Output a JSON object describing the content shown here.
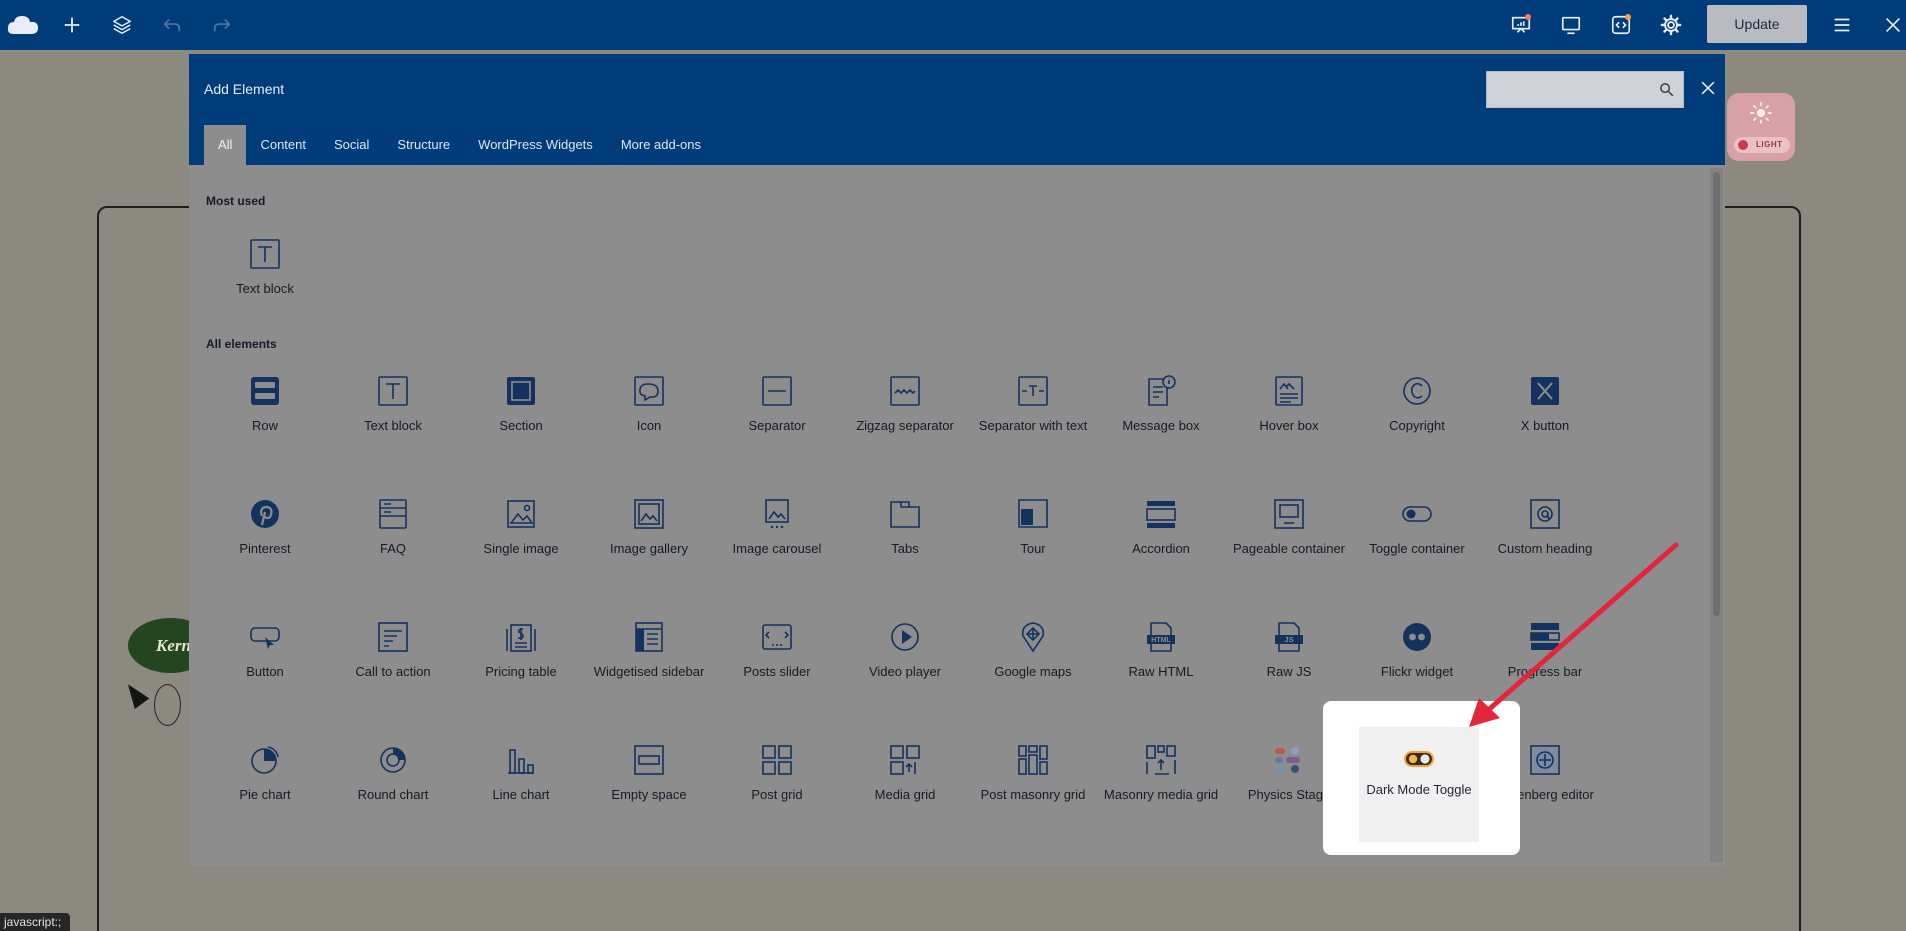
{
  "topbar": {
    "update_label": "Update",
    "icons": [
      "cloud-logo-icon",
      "plus-icon",
      "layers-icon",
      "undo-icon",
      "redo-icon",
      "presentation-icon",
      "monitor-icon",
      "code-icon",
      "settings-icon",
      "menu-icon",
      "close-icon"
    ]
  },
  "modal": {
    "title": "Add Element",
    "search_placeholder": "",
    "tabs": [
      "All",
      "Content",
      "Social",
      "Structure",
      "WordPress Widgets",
      "More add-ons"
    ],
    "active_tab": "All",
    "most_used_title": "Most used",
    "all_elements_title": "All elements",
    "most_used": [
      {
        "name": "text-block",
        "label": "Text block",
        "icon": "text-block-icon"
      }
    ],
    "elements": [
      {
        "name": "row",
        "label": "Row",
        "icon": "row-icon"
      },
      {
        "name": "text-block",
        "label": "Text block",
        "icon": "text-block-icon"
      },
      {
        "name": "section",
        "label": "Section",
        "icon": "section-icon"
      },
      {
        "name": "icon",
        "label": "Icon",
        "icon": "icon-element-icon"
      },
      {
        "name": "separator",
        "label": "Separator",
        "icon": "separator-icon"
      },
      {
        "name": "zigzag-separator",
        "label": "Zigzag separator",
        "icon": "zigzag-separator-icon"
      },
      {
        "name": "separator-with-text",
        "label": "Separator with text",
        "icon": "separator-text-icon"
      },
      {
        "name": "message-box",
        "label": "Message box",
        "icon": "message-box-icon"
      },
      {
        "name": "hover-box",
        "label": "Hover box",
        "icon": "hover-box-icon"
      },
      {
        "name": "copyright",
        "label": "Copyright",
        "icon": "copyright-icon"
      },
      {
        "name": "x-button",
        "label": "X button",
        "icon": "x-logo-icon"
      },
      {
        "name": "pinterest",
        "label": "Pinterest",
        "icon": "pinterest-icon"
      },
      {
        "name": "faq",
        "label": "FAQ",
        "icon": "faq-icon"
      },
      {
        "name": "single-image",
        "label": "Single image",
        "icon": "image-icon"
      },
      {
        "name": "image-gallery",
        "label": "Image gallery",
        "icon": "image-gallery-icon"
      },
      {
        "name": "image-carousel",
        "label": "Image carousel",
        "icon": "image-carousel-icon"
      },
      {
        "name": "tabs",
        "label": "Tabs",
        "icon": "tabs-icon"
      },
      {
        "name": "tour",
        "label": "Tour",
        "icon": "tour-icon"
      },
      {
        "name": "accordion",
        "label": "Accordion",
        "icon": "accordion-icon"
      },
      {
        "name": "pageable-container",
        "label": "Pageable container",
        "icon": "pageable-container-icon"
      },
      {
        "name": "toggle-container",
        "label": "Toggle container",
        "icon": "toggle-icon"
      },
      {
        "name": "custom-heading",
        "label": "Custom heading",
        "icon": "custom-heading-icon"
      },
      {
        "name": "button",
        "label": "Button",
        "icon": "button-icon"
      },
      {
        "name": "call-to-action",
        "label": "Call to action",
        "icon": "call-to-action-icon"
      },
      {
        "name": "pricing-table",
        "label": "Pricing table",
        "icon": "pricing-table-icon"
      },
      {
        "name": "widgetised-sidebar",
        "label": "Widgetised sidebar",
        "icon": "sidebar-icon"
      },
      {
        "name": "posts-slider",
        "label": "Posts slider",
        "icon": "posts-slider-icon"
      },
      {
        "name": "video-player",
        "label": "Video player",
        "icon": "play-icon"
      },
      {
        "name": "google-maps",
        "label": "Google maps",
        "icon": "map-pin-icon"
      },
      {
        "name": "raw-html",
        "label": "Raw HTML",
        "icon": "html-file-icon"
      },
      {
        "name": "raw-js",
        "label": "Raw JS",
        "icon": "js-file-icon"
      },
      {
        "name": "flickr-widget",
        "label": "Flickr widget",
        "icon": "flickr-icon"
      },
      {
        "name": "progress-bar",
        "label": "Progress bar",
        "icon": "progress-bar-icon"
      },
      {
        "name": "pie-chart",
        "label": "Pie chart",
        "icon": "pie-chart-icon"
      },
      {
        "name": "round-chart",
        "label": "Round chart",
        "icon": "round-chart-icon"
      },
      {
        "name": "line-chart",
        "label": "Line chart",
        "icon": "line-chart-icon"
      },
      {
        "name": "empty-space",
        "label": "Empty space",
        "icon": "empty-space-icon"
      },
      {
        "name": "post-grid",
        "label": "Post grid",
        "icon": "grid-icon"
      },
      {
        "name": "media-grid",
        "label": "Media grid",
        "icon": "media-grid-icon"
      },
      {
        "name": "post-masonry-grid",
        "label": "Post masonry grid",
        "icon": "masonry-grid-icon"
      },
      {
        "name": "masonry-media-grid",
        "label": "Masonry media grid",
        "icon": "masonry-media-grid-icon"
      },
      {
        "name": "physics-stage",
        "label": "Physics Stage",
        "icon": "physics-stage-icon"
      },
      {
        "name": "dark-mode-toggle",
        "label": "Dark Mode Toggle",
        "icon": "dark-mode-toggle-icon"
      },
      {
        "name": "gutenberg-editor",
        "label": "Gutenberg editor",
        "icon": "gutenberg-icon"
      }
    ]
  },
  "background": {
    "brand_text": "Kern",
    "light_toggle_label": "LIGHT",
    "status_text": "javascript:;"
  },
  "colors": {
    "topbar": "#003c79",
    "icon_stroke": "#13335e",
    "highlight": "#ffffff",
    "arrow": "#e3253a"
  }
}
